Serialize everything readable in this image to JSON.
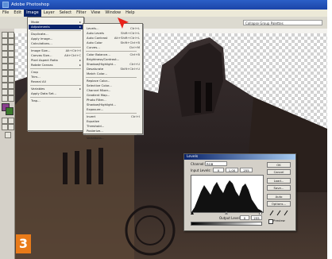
{
  "window": {
    "title": "Adobe Photoshop"
  },
  "menubar": [
    "File",
    "Edit",
    "Image",
    "Layer",
    "Select",
    "Filter",
    "View",
    "Window",
    "Help"
  ],
  "options_bar": {
    "field": "Collapse Group Palettes"
  },
  "image_menu": {
    "items": [
      {
        "label": "Mode",
        "shortcut": "▸"
      },
      {
        "label": "Adjustments",
        "shortcut": "▸",
        "highlighted": true
      },
      {
        "label": "Duplicate...",
        "shortcut": ""
      },
      {
        "label": "Apply Image...",
        "shortcut": ""
      },
      {
        "label": "Calculations...",
        "shortcut": ""
      },
      {
        "label": "Image Size...",
        "shortcut": "Alt+Ctrl+I"
      },
      {
        "label": "Canvas Size...",
        "shortcut": "Alt+Ctrl+C"
      },
      {
        "label": "Pixel Aspect Ratio",
        "shortcut": "▸"
      },
      {
        "label": "Rotate Canvas",
        "shortcut": "▸"
      },
      {
        "label": "Crop",
        "shortcut": ""
      },
      {
        "label": "Trim...",
        "shortcut": ""
      },
      {
        "label": "Reveal All",
        "shortcut": ""
      },
      {
        "label": "Variables",
        "shortcut": "▸"
      },
      {
        "label": "Apply Data Set...",
        "shortcut": ""
      },
      {
        "label": "Trap...",
        "shortcut": ""
      }
    ]
  },
  "adjustments_submenu": {
    "items": [
      {
        "label": "Levels...",
        "shortcut": "Ctrl+L"
      },
      {
        "label": "Auto Levels",
        "shortcut": "Shift+Ctrl+L"
      },
      {
        "label": "Auto Contrast",
        "shortcut": "Alt+Shift+Ctrl+L"
      },
      {
        "label": "Auto Color",
        "shortcut": "Shift+Ctrl+B"
      },
      {
        "label": "Curves...",
        "shortcut": "Ctrl+M"
      },
      {
        "label": "Color Balance...",
        "shortcut": "Ctrl+B"
      },
      {
        "label": "Brightness/Contrast...",
        "shortcut": ""
      },
      {
        "label": "Shadow/Highlight...",
        "shortcut": "Ctrl+U"
      },
      {
        "label": "Desaturate",
        "shortcut": "Shift+Ctrl+U"
      },
      {
        "label": "Match Color...",
        "shortcut": ""
      },
      {
        "label": "Replace Color...",
        "shortcut": ""
      },
      {
        "label": "Selective Color...",
        "shortcut": ""
      },
      {
        "label": "Channel Mixer...",
        "shortcut": ""
      },
      {
        "label": "Gradient Map...",
        "shortcut": ""
      },
      {
        "label": "Photo Filter...",
        "shortcut": ""
      },
      {
        "label": "Shadow/Highlight...",
        "shortcut": ""
      },
      {
        "label": "Exposure...",
        "shortcut": ""
      },
      {
        "label": "Invert",
        "shortcut": "Ctrl+I"
      },
      {
        "label": "Equalize",
        "shortcut": ""
      },
      {
        "label": "Threshold...",
        "shortcut": ""
      },
      {
        "label": "Posterize...",
        "shortcut": ""
      },
      {
        "label": "Variations...",
        "shortcut": ""
      }
    ]
  },
  "levels_dialog": {
    "title": "Levels",
    "channel_label": "Channel:",
    "channel_value": "RGB",
    "input_label": "Input Levels:",
    "input_values": [
      "0",
      "1,00",
      "255"
    ],
    "output_label": "Output Levels:",
    "output_values": [
      "0",
      "255"
    ],
    "buttons": [
      "OK",
      "Cancel",
      "Load...",
      "Save...",
      "Auto",
      "Options..."
    ],
    "preview_label": "Preview"
  },
  "step_badge": "3",
  "colors": {
    "accent": "#e97b1a",
    "selection": "#0a246a",
    "arrow": "#e8231a"
  }
}
